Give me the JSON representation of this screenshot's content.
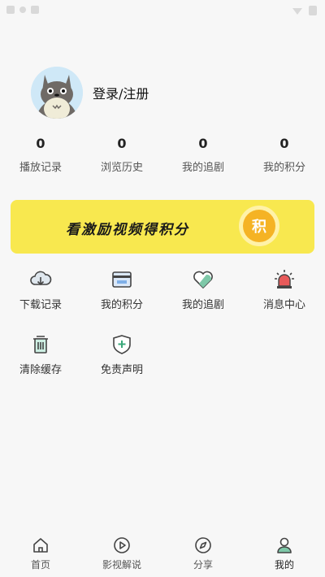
{
  "user": {
    "login_label": "登录/注册"
  },
  "stats": [
    {
      "value": "0",
      "label": "播放记录"
    },
    {
      "value": "0",
      "label": "浏览历史"
    },
    {
      "value": "0",
      "label": "我的追剧"
    },
    {
      "value": "0",
      "label": "我的积分"
    }
  ],
  "banner": {
    "text": "看激励视频得积分",
    "badge": "积"
  },
  "menu": [
    {
      "label": "下载记录",
      "icon": "cloud-download-icon"
    },
    {
      "label": "我的积分",
      "icon": "card-icon"
    },
    {
      "label": "我的追剧",
      "icon": "heart-icon"
    },
    {
      "label": "消息中心",
      "icon": "alarm-icon"
    },
    {
      "label": "清除缓存",
      "icon": "trash-icon"
    },
    {
      "label": "免责声明",
      "icon": "shield-icon"
    }
  ],
  "tabs": [
    {
      "label": "首页",
      "icon": "home-icon"
    },
    {
      "label": "影视解说",
      "icon": "play-icon"
    },
    {
      "label": "分享",
      "icon": "compass-icon"
    },
    {
      "label": "我的",
      "icon": "user-icon"
    }
  ],
  "colors": {
    "banner_bg": "#f8e84f",
    "badge": "#f5b324",
    "accent_heart": "#7ec8a8",
    "accent_alarm": "#e85a5a"
  }
}
